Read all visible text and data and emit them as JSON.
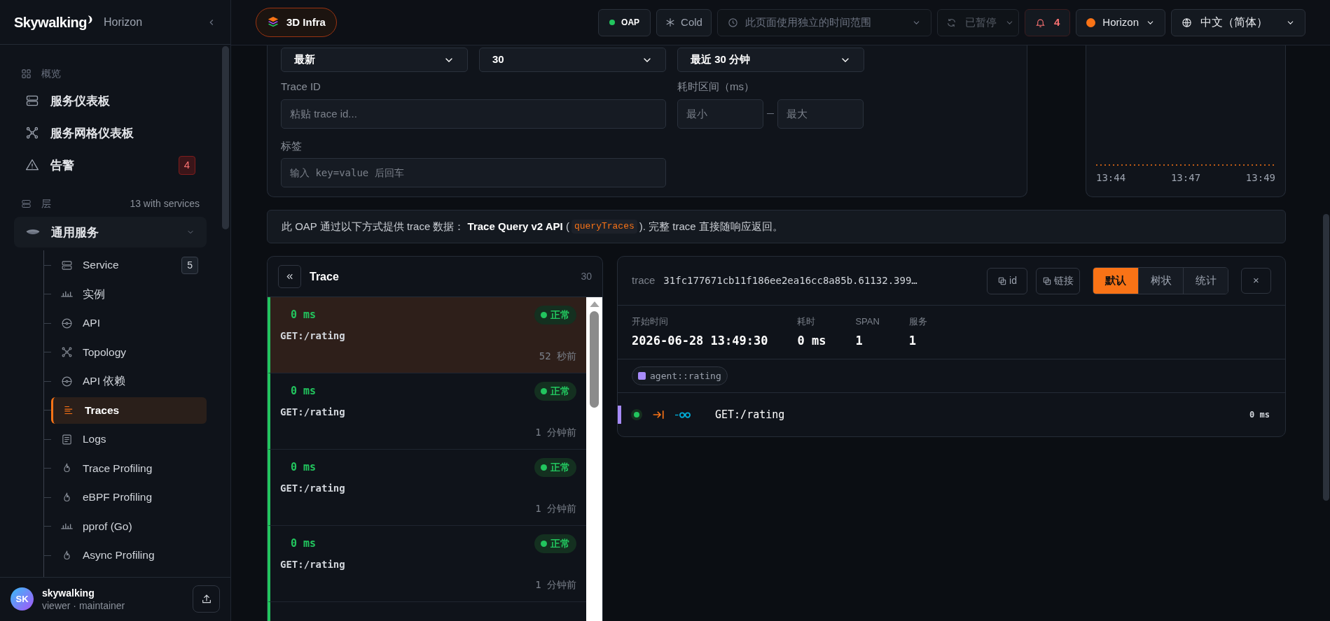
{
  "sidebar": {
    "brand": "Skywalking",
    "subtitle": "Horizon",
    "overview": {
      "title": "概览",
      "items": [
        {
          "label": "服务仪表板",
          "kind": "server"
        },
        {
          "label": "服务网格仪表板",
          "kind": "mesh"
        },
        {
          "label": "告警",
          "kind": "alert",
          "badge": "4"
        }
      ]
    },
    "layers": {
      "title": "层",
      "count": "13 with services",
      "group": {
        "label": "通用服务",
        "expanded": true,
        "children": [
          {
            "label": "Service",
            "kind": "server",
            "badge": "5",
            "selected": false
          },
          {
            "label": "实例",
            "kind": "bars",
            "selected": false
          },
          {
            "label": "API",
            "kind": "api",
            "selected": false
          },
          {
            "label": "Topology",
            "kind": "mesh",
            "selected": false
          },
          {
            "label": "API 依赖",
            "kind": "api",
            "selected": false
          },
          {
            "label": "Traces",
            "kind": "traces",
            "selected": true
          },
          {
            "label": "Logs",
            "kind": "doc",
            "selected": false
          },
          {
            "label": "Trace Profiling",
            "kind": "flame",
            "selected": false
          },
          {
            "label": "eBPF Profiling",
            "kind": "flame",
            "selected": false
          },
          {
            "label": "pprof (Go)",
            "kind": "bars",
            "selected": false
          },
          {
            "label": "Async Profiling",
            "kind": "flame",
            "selected": false
          }
        ]
      }
    },
    "user": {
      "initials": "SK",
      "name": "skywalking",
      "role": "viewer · maintainer"
    }
  },
  "topbar": {
    "project": "3D Infra",
    "oap": {
      "label": "OAP",
      "color": "#22c55e"
    },
    "cold": "Cold",
    "time_range": {
      "label": "此页面使用独立的时间范围",
      "disabled": true
    },
    "refresh": {
      "label": "已暂停",
      "disabled": true
    },
    "alerts": "4",
    "instance": {
      "label": "Horizon",
      "color": "#f97316"
    },
    "language": "中文（简体）"
  },
  "filters": {
    "selects": [
      "最新",
      "30",
      "最近 30 分钟"
    ],
    "trace_id": {
      "label": "Trace ID",
      "placeholder": "粘贴 trace id..."
    },
    "duration": {
      "label": "耗时区间（ms）",
      "min_placeholder": "最小",
      "max_placeholder": "最大"
    },
    "tags": {
      "label": "标签",
      "placeholder": "输入 key=value 后回车"
    }
  },
  "chart": {
    "x_labels": [
      "13:44",
      "13:47",
      "13:49"
    ]
  },
  "info": {
    "before": "此 OAP 通过以下方式提供 trace 数据： **Trace Query v2 API** (",
    "code": "queryTraces",
    "after": "). 完整 trace 直接随响应返回。"
  },
  "trace_list": {
    "title": "Trace",
    "count": "30",
    "rows": [
      {
        "duration": "0 ms",
        "status": "正常",
        "endpoint": "GET:/rating",
        "time": "52 秒前",
        "selected": true
      },
      {
        "duration": "0 ms",
        "status": "正常",
        "endpoint": "GET:/rating",
        "time": "1 分钟前",
        "selected": false
      },
      {
        "duration": "0 ms",
        "status": "正常",
        "endpoint": "GET:/rating",
        "time": "1 分钟前",
        "selected": false
      },
      {
        "duration": "0 ms",
        "status": "正常",
        "endpoint": "GET:/rating",
        "time": "1 分钟前",
        "selected": false
      }
    ]
  },
  "detail": {
    "label": "trace",
    "trace_id": "31fc177671cb11f186ee2ea16cc8a85b.61132.399…",
    "copy_buttons": [
      "id",
      "链接"
    ],
    "views": [
      {
        "label": "默认",
        "selected": true
      },
      {
        "label": "树状",
        "selected": false
      },
      {
        "label": "统计",
        "selected": false
      }
    ],
    "close": "×",
    "stats": [
      {
        "label": "开始时间",
        "value": "2026-06-28 13:49:30"
      },
      {
        "label": "耗时",
        "value": "0 ms"
      },
      {
        "label": "SPAN",
        "value": "1"
      },
      {
        "label": "服务",
        "value": "1"
      }
    ],
    "services": [
      {
        "name": "agent::rating",
        "color": "#a78bfa"
      }
    ],
    "spans": [
      {
        "name": "GET:/rating",
        "duration": "0 ms",
        "color": "#a78bfa"
      }
    ]
  }
}
